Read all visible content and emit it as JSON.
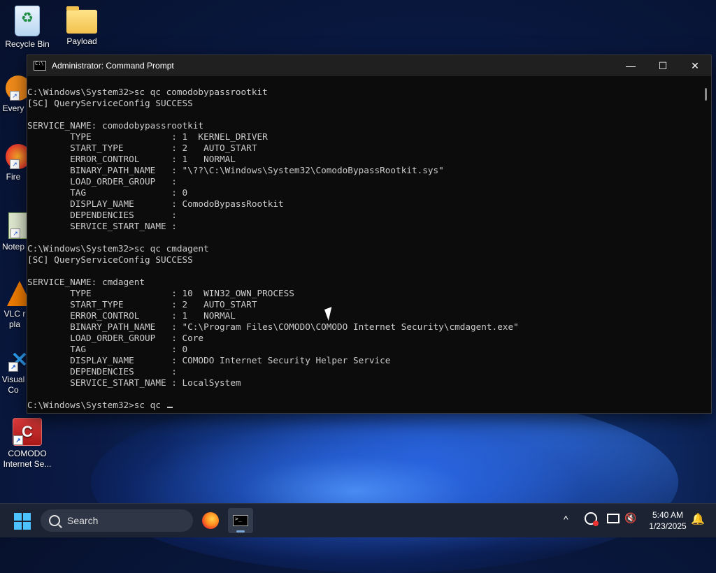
{
  "desktop": {
    "icons": [
      {
        "label": "Recycle Bin"
      },
      {
        "label": "Payload"
      },
      {
        "label": "Every"
      },
      {
        "label": "Fire"
      },
      {
        "label": "Notep"
      },
      {
        "label": "VLC r\npla"
      },
      {
        "label": "Visual\nCo"
      },
      {
        "label": "COMODO\nInternet Se..."
      }
    ]
  },
  "window": {
    "title": "Administrator: Command Prompt",
    "minimize": "—",
    "maximize": "☐",
    "close": "✕"
  },
  "console": {
    "lines": [
      "C:\\Windows\\System32>sc qc comodobypassrootkit",
      "[SC] QueryServiceConfig SUCCESS",
      "",
      "SERVICE_NAME: comodobypassrootkit",
      "        TYPE               : 1  KERNEL_DRIVER",
      "        START_TYPE         : 2   AUTO_START",
      "        ERROR_CONTROL      : 1   NORMAL",
      "        BINARY_PATH_NAME   : \"\\??\\C:\\Windows\\System32\\ComodoBypassRootkit.sys\"",
      "        LOAD_ORDER_GROUP   :",
      "        TAG                : 0",
      "        DISPLAY_NAME       : ComodoBypassRootkit",
      "        DEPENDENCIES       :",
      "        SERVICE_START_NAME :",
      "",
      "C:\\Windows\\System32>sc qc cmdagent",
      "[SC] QueryServiceConfig SUCCESS",
      "",
      "SERVICE_NAME: cmdagent",
      "        TYPE               : 10  WIN32_OWN_PROCESS",
      "        START_TYPE         : 2   AUTO_START",
      "        ERROR_CONTROL      : 1   NORMAL",
      "        BINARY_PATH_NAME   : \"C:\\Program Files\\COMODO\\COMODO Internet Security\\cmdagent.exe\"",
      "        LOAD_ORDER_GROUP   : Core",
      "        TAG                : 0",
      "        DISPLAY_NAME       : COMODO Internet Security Helper Service",
      "        DEPENDENCIES       :",
      "        SERVICE_START_NAME : LocalSystem",
      ""
    ],
    "prompt_line": "C:\\Windows\\System32>sc qc "
  },
  "taskbar": {
    "search_label": "Search",
    "tray": {
      "chevron": "^",
      "time": "5:40 AM",
      "date": "1/23/2025"
    }
  }
}
